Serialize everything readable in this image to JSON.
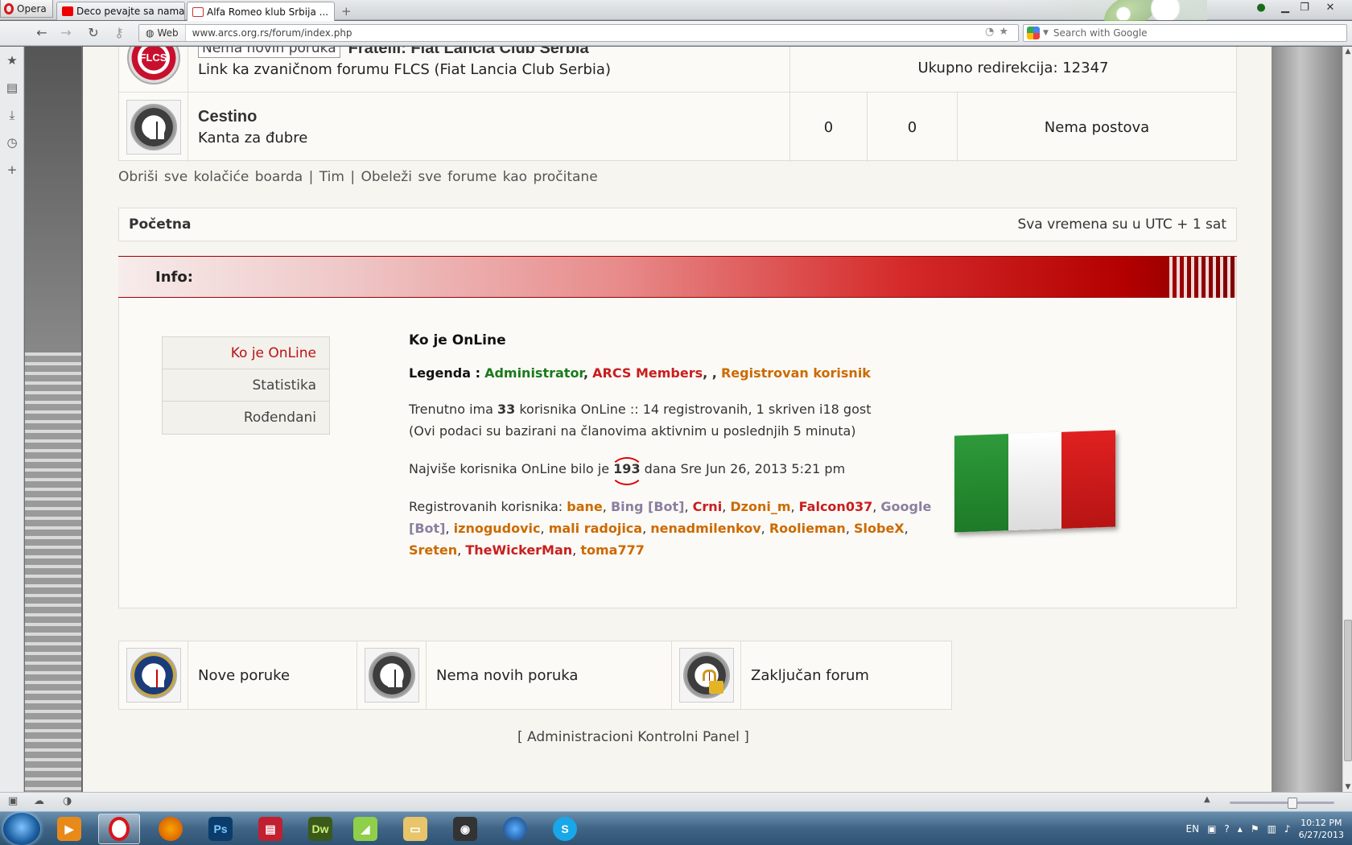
{
  "browser": {
    "menu_label": "Opera",
    "tabs": [
      {
        "title": "Deco pevajte sa nama -...",
        "close": "×"
      },
      {
        "title": "Alfa Romeo klub Srbija ...",
        "close": "×"
      }
    ],
    "new_tab": "+",
    "address": {
      "badge": "Web",
      "url": "www.arcs.org.rs/forum/index.php"
    },
    "search_placeholder": "Search with Google"
  },
  "forums": [
    {
      "cut_off_text": "Nema novih poruka",
      "title": "Fratelli: Fiat Lancia Club Serbia",
      "description": "Link ka zvaničnom forumu FLCS (Fiat Lancia Club Serbia)",
      "redirects": "Ukupno redirekcija: 12347"
    },
    {
      "title": "Cestino",
      "description": "Kanta za đubre",
      "topics": "0",
      "posts": "0",
      "last_post": "Nema postova"
    }
  ],
  "board_links": {
    "delete_cookies": "Obriši sve kolačiće boarda",
    "sep": "|",
    "team": "Tim",
    "mark_read": "Obeleži sve forume kao pročitane"
  },
  "breadcrumb_bar": {
    "home": "Početna",
    "timezone": "Sva vremena su u UTC + 1 sat"
  },
  "info": {
    "heading": "Info:",
    "nav": [
      "Ko je OnLine",
      "Statistika",
      "Rođendani"
    ],
    "online": {
      "title": "Ko je OnLine",
      "legend_label": "Legenda :",
      "legend_admin": "Administrator",
      "legend_members": "ARCS Members",
      "legend_sep": ", ,",
      "legend_registered": "Registrovan korisnik",
      "line1_a": "Trenutno ima",
      "line1_count": "33",
      "line1_b": "korisnika OnLine :: 14 registrovanih, 1 skriven i18 gost",
      "line2": "(Ovi podaci su bazirani na članovima aktivnim u poslednjih 5 minuta)",
      "max_a": "Najviše korisnika OnLine bilo je",
      "max_count": "193",
      "max_b": "dana Sre Jun 26, 2013 5:21 pm",
      "users_label": "Registrovanih korisnika:",
      "users": [
        {
          "name": "bane",
          "type": "reg"
        },
        {
          "name": "Bing [Bot]",
          "type": "bot"
        },
        {
          "name": "Crni",
          "type": "member"
        },
        {
          "name": "Dzoni_m",
          "type": "reg"
        },
        {
          "name": "Falcon037",
          "type": "member"
        },
        {
          "name": "Google [Bot]",
          "type": "bot"
        },
        {
          "name": "iznogudovic",
          "type": "reg"
        },
        {
          "name": "mali radojica",
          "type": "reg"
        },
        {
          "name": "nenadmilenkov",
          "type": "reg"
        },
        {
          "name": "Roolieman",
          "type": "reg"
        },
        {
          "name": "SlobeX",
          "type": "reg"
        },
        {
          "name": "Sreten",
          "type": "reg"
        },
        {
          "name": "TheWickerMan",
          "type": "member"
        },
        {
          "name": "toma777",
          "type": "reg"
        }
      ]
    }
  },
  "legend_icons": [
    {
      "label": "Nove poruke"
    },
    {
      "label": "Nema novih poruka"
    },
    {
      "label": "Zaključan forum"
    }
  ],
  "acp_link": "[ Administracioni Kontrolni Panel ]",
  "taskbar": {
    "lang": "EN",
    "time": "10:12 PM",
    "date": "6/27/2013"
  },
  "colors": {
    "admin": "#1b7a1b",
    "member": "#c81e1e",
    "registered": "#cc6a00",
    "bot": "#8a7fa0",
    "accent": "#b30000"
  }
}
